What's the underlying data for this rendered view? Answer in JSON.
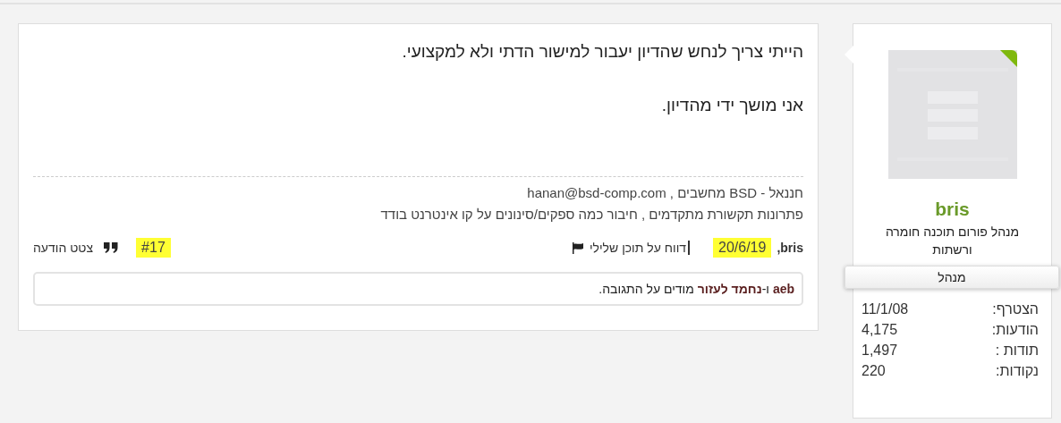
{
  "user": {
    "online": true,
    "name": "bris",
    "title": "מנהל פורום תוכנה חומרה ורשתות",
    "rank": "מנהל",
    "stats": [
      {
        "label": "הצטרף:",
        "value": "11/1/08"
      },
      {
        "label": "הודעות:",
        "value": "4,175"
      },
      {
        "label": "תודות :",
        "value": "1,497"
      },
      {
        "label": "נקודות:",
        "value": "220"
      }
    ]
  },
  "post": {
    "paragraphs": [
      "הייתי צריך לנחש שהדיון יעבור למישור הדתי ולא למקצועי.",
      "אני מושך ידי מהדיון."
    ],
    "signature": [
      "חננאל - BSD מחשבים , hanan@bsd-comp.com",
      "פתרונות תקשורת מתקדמים , חיבור כמה ספקים/סינונים על קו אינטרנט בודד"
    ],
    "author": "bris,",
    "date": {
      "text": "20/6/19",
      "highlighted": true
    },
    "report": "דווח על תוכן שלילי",
    "number": {
      "text": "#17",
      "highlighted": true
    },
    "quote": "צטט הודעה",
    "likes": "**aeb** ו-**נחמד לעזור** מודים על התגובה."
  }
}
